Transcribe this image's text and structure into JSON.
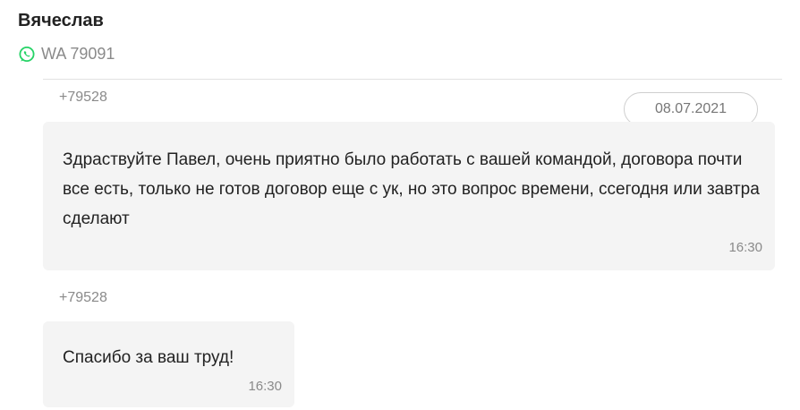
{
  "header": {
    "contact_name": "Вячеслав",
    "channel_label": "WA 79091",
    "channel_icon": "whatsapp-icon",
    "channel_color": "#25D366"
  },
  "date_separator": "08.07.2021",
  "messages": [
    {
      "sender": "+79528",
      "text": "Здраствуйте Павел, очень приятно было работать с вашей командой, договора почти все есть, только не готов договор еще с ук, но это вопрос времени, ссегодня или завтра сделают",
      "time": "16:30"
    },
    {
      "sender": "+79528",
      "text": "Спасибо за ваш труд!",
      "time": "16:30"
    }
  ]
}
